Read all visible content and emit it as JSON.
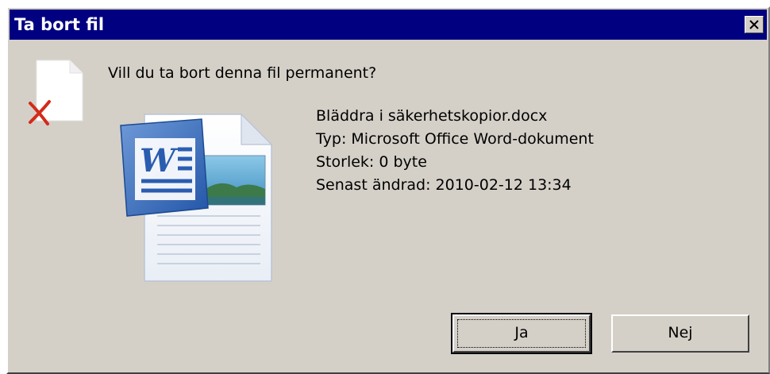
{
  "window": {
    "title": "Ta bort fil",
    "close_symbol": "✕"
  },
  "question": "Vill du ta bort denna fil permanent?",
  "file": {
    "name": "Bläddra i säkerhetskopior.docx",
    "type": "Typ: Microsoft Office Word-dokument",
    "size": "Storlek: 0 byte",
    "modified": "Senast ändrad: 2010-02-12 13:34",
    "icon": "word-document-icon"
  },
  "buttons": {
    "yes_label": "Ja",
    "no_label": "Nej"
  },
  "colors": {
    "titlebar": "#000080",
    "dialog_bg": "#d4d0c8",
    "delete_x": "#d42a1a"
  }
}
